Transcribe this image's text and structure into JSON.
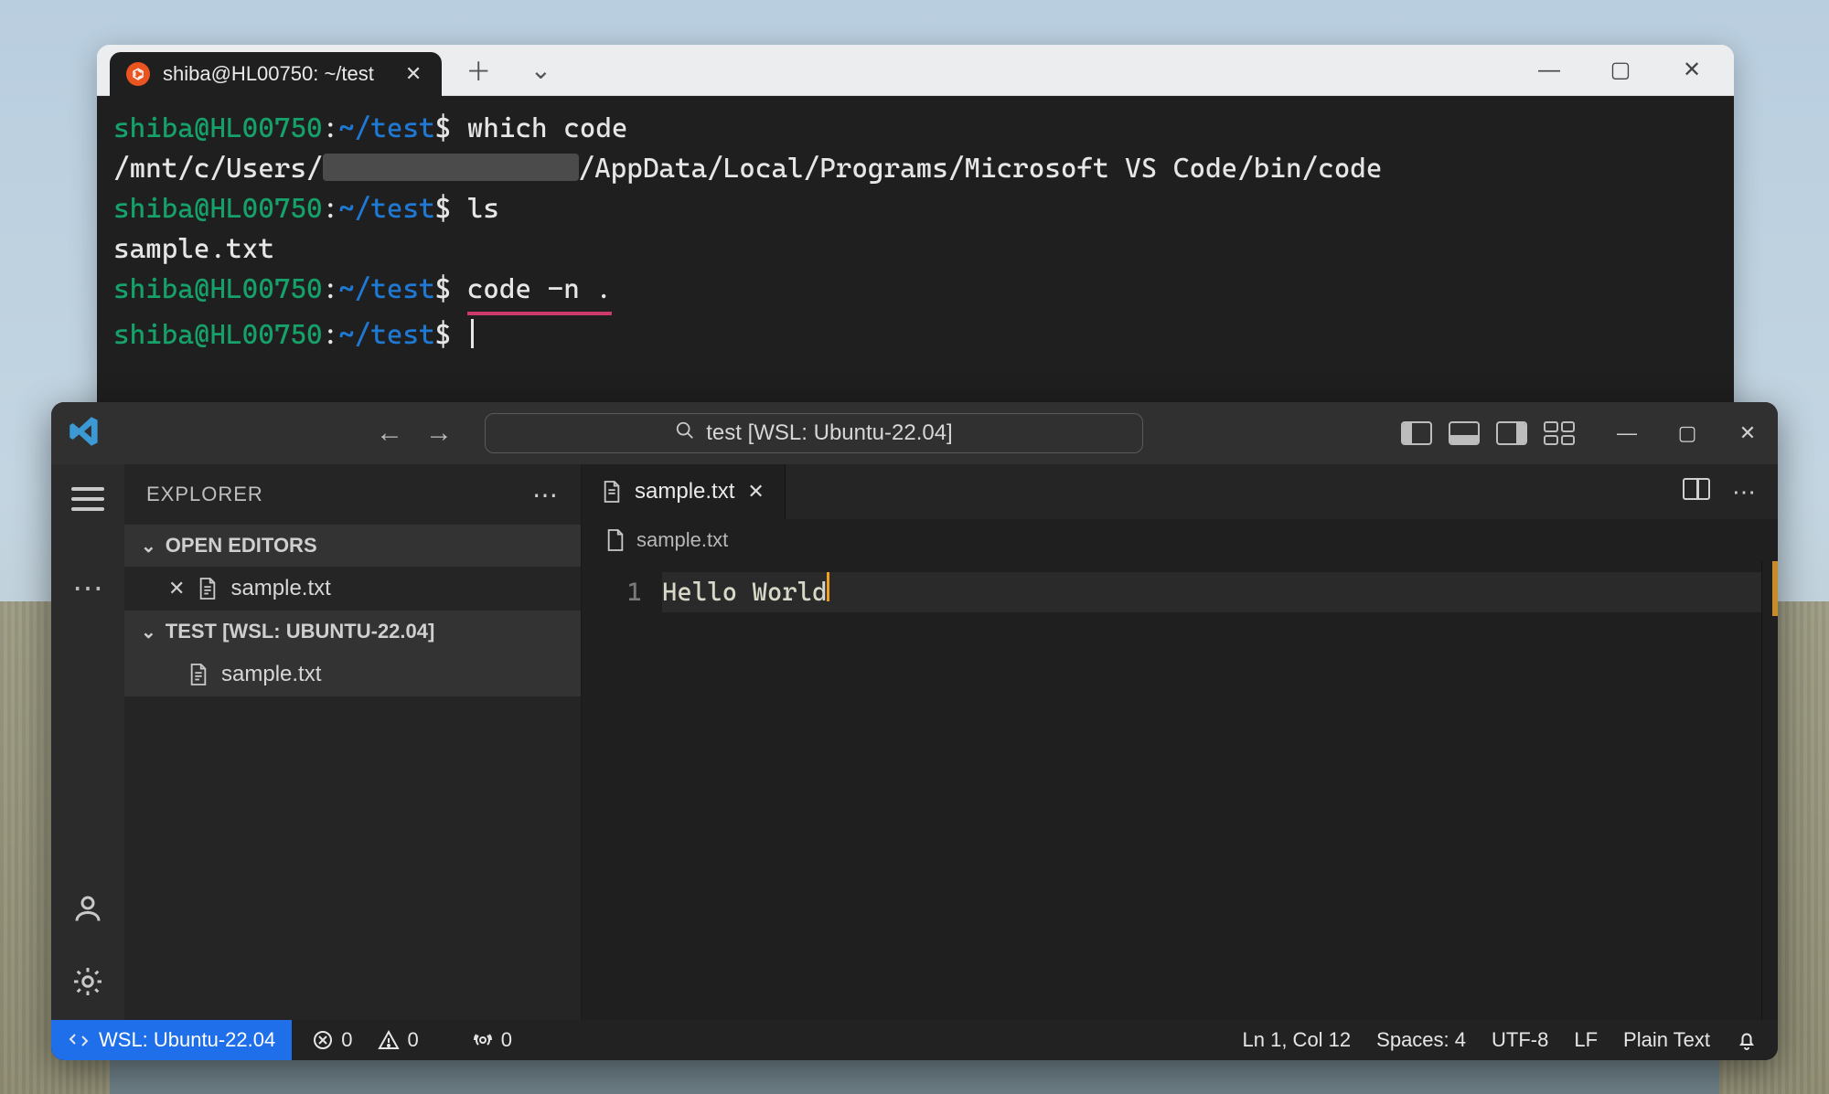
{
  "terminal": {
    "tab_title": "shiba@HL00750: ~/test",
    "lines": {
      "l1_user": "shiba@HL00750",
      "l1_path": "~/test",
      "l1_cmd": "which code",
      "l2_before": "/mnt/c/Users/",
      "l2_after": "/AppData/Local/Programs/Microsoft VS Code/bin/code",
      "l3_user": "shiba@HL00750",
      "l3_path": "~/test",
      "l3_cmd": "ls",
      "l4": "sample.txt",
      "l5_user": "shiba@HL00750",
      "l5_path": "~/test",
      "l5_cmd": "code -n .",
      "l6_user": "shiba@HL00750",
      "l6_path": "~/test"
    }
  },
  "vscode": {
    "search_placeholder": "test [WSL: Ubuntu-22.04]",
    "explorer": {
      "title": "EXPLORER",
      "open_editors_label": "OPEN EDITORS",
      "open_file": "sample.txt",
      "workspace_label": "TEST [WSL: UBUNTU-22.04]",
      "workspace_file": "sample.txt"
    },
    "editor": {
      "tab_label": "sample.txt",
      "breadcrumb": "sample.txt",
      "line_number": "1",
      "content": "Hello World"
    },
    "statusbar": {
      "remote": "WSL: Ubuntu-22.04",
      "errors": "0",
      "warnings": "0",
      "ports": "0",
      "cursor": "Ln 1, Col 12",
      "spaces": "Spaces: 4",
      "encoding": "UTF-8",
      "eol": "LF",
      "language": "Plain Text"
    }
  }
}
